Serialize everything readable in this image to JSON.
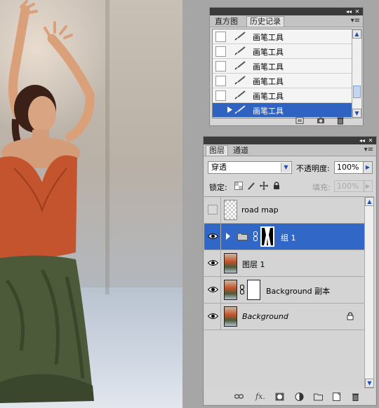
{
  "photo": {
    "description_icon": "photo-dancer"
  },
  "history_panel": {
    "tabs": [
      {
        "label": "直方图",
        "active": false
      },
      {
        "label": "历史记录",
        "active": true
      }
    ],
    "items": [
      {
        "label": "画笔工具",
        "selected": false
      },
      {
        "label": "画笔工具",
        "selected": false
      },
      {
        "label": "画笔工具",
        "selected": false
      },
      {
        "label": "画笔工具",
        "selected": false
      },
      {
        "label": "画笔工具",
        "selected": false
      },
      {
        "label": "画笔工具",
        "selected": true
      }
    ],
    "footer_icons": [
      "new-document-from-state-icon",
      "snapshot-camera-icon",
      "trash-icon"
    ]
  },
  "layers_panel": {
    "tabs": [
      {
        "label": "图层",
        "active": true
      },
      {
        "label": "通道",
        "active": false
      }
    ],
    "blend_mode": "穿透",
    "opacity_label": "不透明度:",
    "opacity_value": "100%",
    "lock_label": "锁定:",
    "fill_label": "填充:",
    "fill_value": "100%",
    "layers": [
      {
        "name": "road map",
        "visible": false,
        "type": "normal",
        "selected": false,
        "italic": false
      },
      {
        "name": "组 1",
        "visible": true,
        "type": "group",
        "selected": true,
        "italic": false
      },
      {
        "name": "图层 1",
        "visible": true,
        "type": "normal",
        "selected": false,
        "italic": false
      },
      {
        "name": "Background 副本",
        "visible": true,
        "type": "masked",
        "selected": false,
        "italic": false
      },
      {
        "name": "Background",
        "visible": true,
        "type": "background",
        "selected": false,
        "italic": true,
        "locked": true
      }
    ],
    "footer_icons": [
      "link-layers-icon",
      "layer-style-fx-icon",
      "add-mask-icon",
      "adjustment-layer-icon",
      "new-group-icon",
      "new-layer-icon",
      "delete-layer-icon"
    ]
  },
  "colors": {
    "selection": "#3168c7",
    "panel_bg": "#d4d4d4",
    "titlebar": "#3b3b3b"
  }
}
